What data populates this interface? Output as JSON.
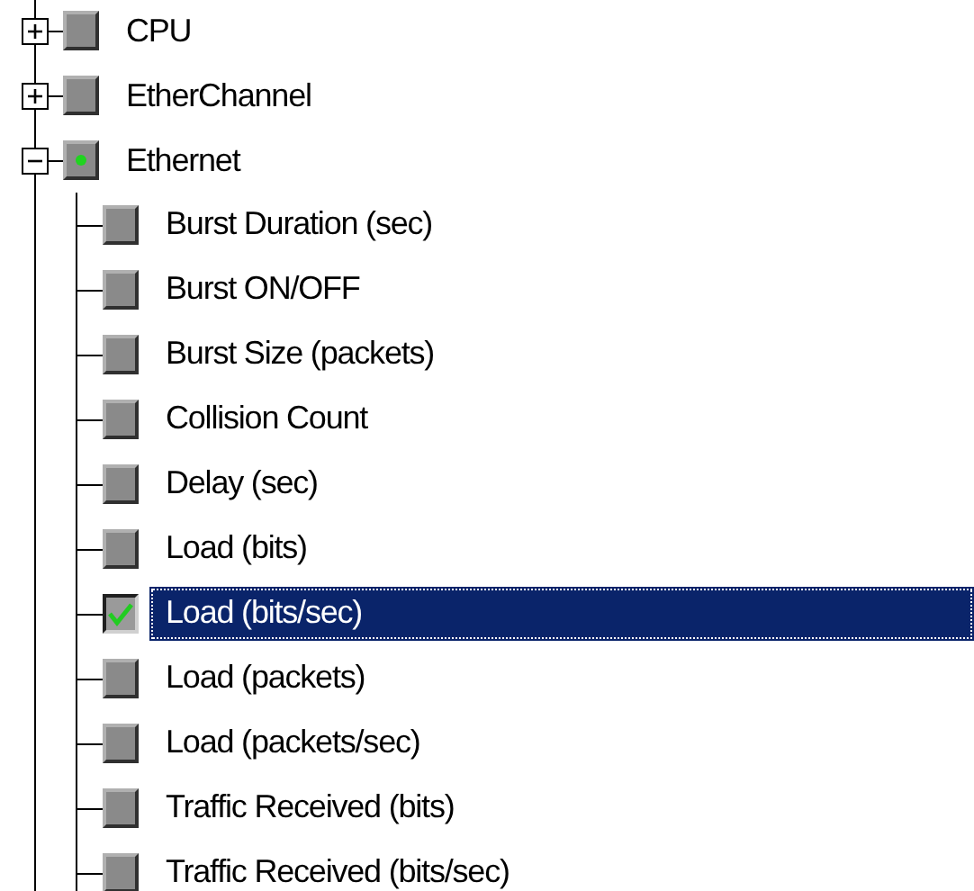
{
  "tree": [
    {
      "label": "CPU",
      "expanded": false,
      "checked": false,
      "partial": false,
      "selected": false
    },
    {
      "label": "EtherChannel",
      "expanded": false,
      "checked": false,
      "partial": false,
      "selected": false
    },
    {
      "label": "Ethernet",
      "expanded": true,
      "checked": false,
      "partial": true,
      "selected": false,
      "children": [
        {
          "label": "Burst Duration (sec)",
          "checked": false,
          "partial": false,
          "selected": false
        },
        {
          "label": "Burst ON/OFF",
          "checked": false,
          "partial": false,
          "selected": false
        },
        {
          "label": "Burst Size (packets)",
          "checked": false,
          "partial": false,
          "selected": false
        },
        {
          "label": "Collision Count",
          "checked": false,
          "partial": false,
          "selected": false
        },
        {
          "label": "Delay (sec)",
          "checked": false,
          "partial": false,
          "selected": false
        },
        {
          "label": "Load (bits)",
          "checked": false,
          "partial": false,
          "selected": false
        },
        {
          "label": "Load (bits/sec)",
          "checked": true,
          "partial": false,
          "selected": true
        },
        {
          "label": "Load (packets)",
          "checked": false,
          "partial": false,
          "selected": false
        },
        {
          "label": "Load (packets/sec)",
          "checked": false,
          "partial": false,
          "selected": false
        },
        {
          "label": "Traffic Received (bits)",
          "checked": false,
          "partial": false,
          "selected": false
        },
        {
          "label": "Traffic Received (bits/sec)",
          "checked": false,
          "partial": false,
          "selected": false
        }
      ]
    }
  ]
}
